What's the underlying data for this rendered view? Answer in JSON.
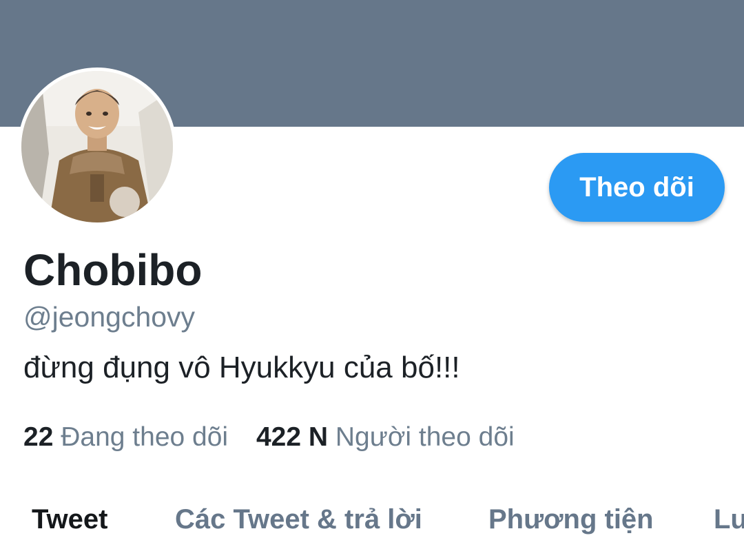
{
  "profile": {
    "display_name": "Chobibo",
    "handle": "@jeongchovy",
    "bio": "đừng đụng vô Hyukkyu của bố!!!",
    "follow_button_label": "Theo dõi",
    "stats": {
      "following_count": "22",
      "following_label": "Đang theo dõi",
      "followers_count": "422 N",
      "followers_label": "Người theo dõi"
    }
  },
  "tabs": [
    {
      "label": "Tweet",
      "active": true
    },
    {
      "label": "Các Tweet & trả lời",
      "active": false
    },
    {
      "label": "Phương tiện",
      "active": false
    },
    {
      "label": "Lượt thích",
      "active": false
    }
  ],
  "colors": {
    "banner": "#66778a",
    "accent": "#2b9af3",
    "secondary_text": "#6d7e8e",
    "primary_text": "#1c2126"
  }
}
